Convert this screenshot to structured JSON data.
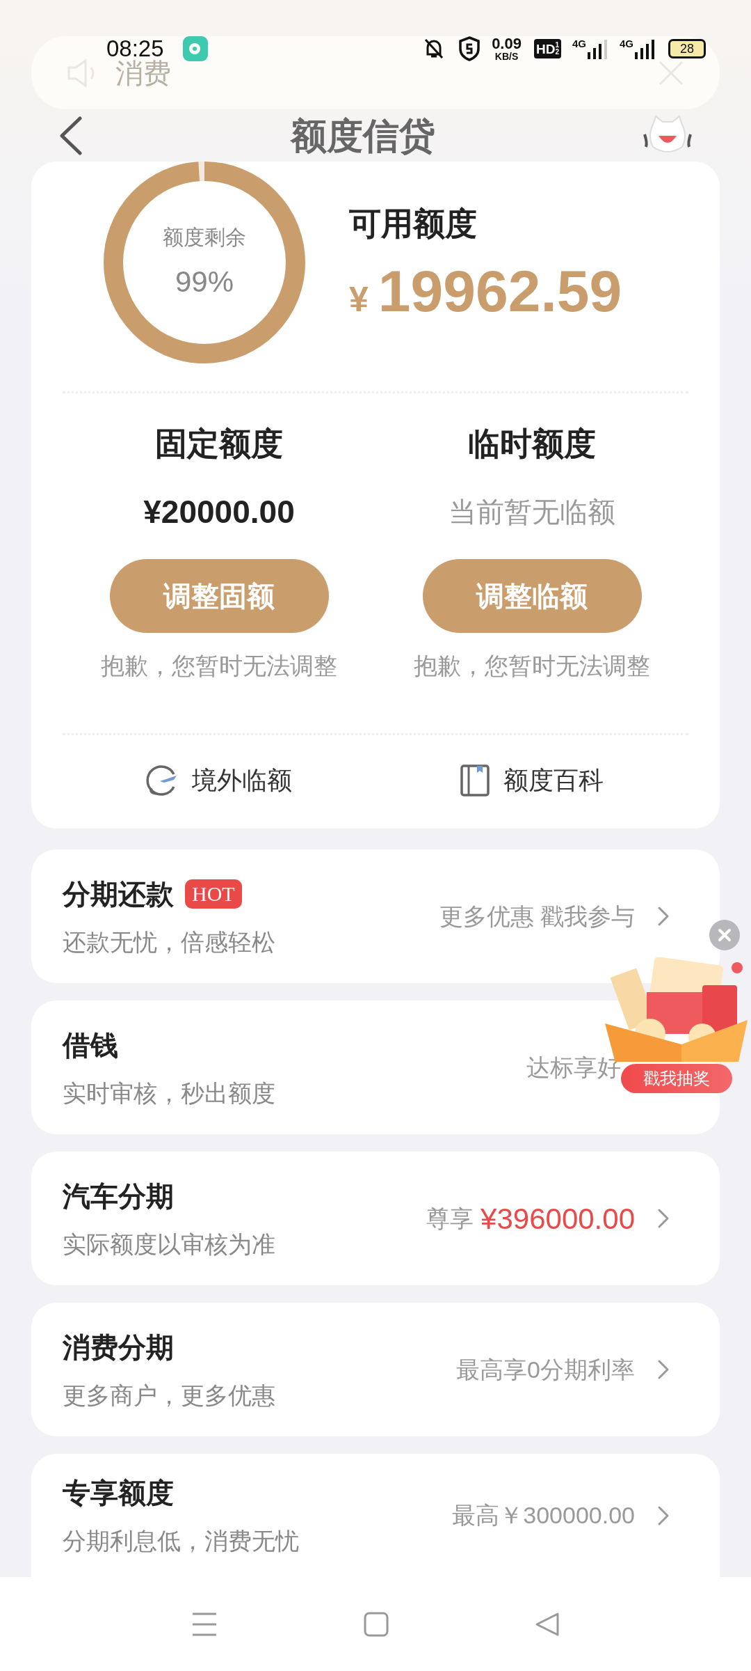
{
  "status_bar": {
    "time": "08:25",
    "speed_value": "0.09",
    "speed_unit": "KB/S",
    "hd": "HD",
    "hd_sub": "1",
    "hd_sub2": "2",
    "net1": "4G",
    "net2": "4G",
    "battery": "28"
  },
  "toast": {
    "text": "消费"
  },
  "header": {
    "title": "额度信贷"
  },
  "credit": {
    "ring_label": "额度剩余",
    "ring_percent": "99%",
    "level": 0.99,
    "available_label": "可用额度",
    "currency": "¥",
    "available_amount": "19962.59",
    "columns": [
      {
        "title": "固定额度",
        "value": "¥20000.00",
        "muted": false,
        "button": "调整固额",
        "note": "抱歉，您暂时无法调整"
      },
      {
        "title": "临时额度",
        "value": "当前暂无临额",
        "muted": true,
        "button": "调整临额",
        "note": "抱歉，您暂时无法调整"
      }
    ],
    "links": [
      {
        "kind": "plane",
        "label": "境外临额"
      },
      {
        "kind": "book",
        "label": "额度百科"
      }
    ]
  },
  "services": [
    {
      "title": "分期还款",
      "badge": "HOT",
      "subtitle": "还款无忧，倍感轻松",
      "right": "更多优惠 戳我参与",
      "chevron": true
    },
    {
      "title": "借钱",
      "subtitle": "实时审核，秒出额度",
      "right": "达标享好",
      "chevron": false
    },
    {
      "title": "汽车分期",
      "subtitle": "实际额度以审核为准",
      "prefix": "尊享",
      "highlight": "¥396000.00",
      "chevron": true
    },
    {
      "title": "消费分期",
      "subtitle": "更多商户，更多优惠",
      "right": "最高享0分期利率",
      "chevron": true
    },
    {
      "title": "专享额度",
      "subtitle": "分期利息低，消费无忧",
      "right": "最高￥300000.00",
      "chevron": true
    }
  ],
  "promo": {
    "button": "戳我抽奖"
  }
}
